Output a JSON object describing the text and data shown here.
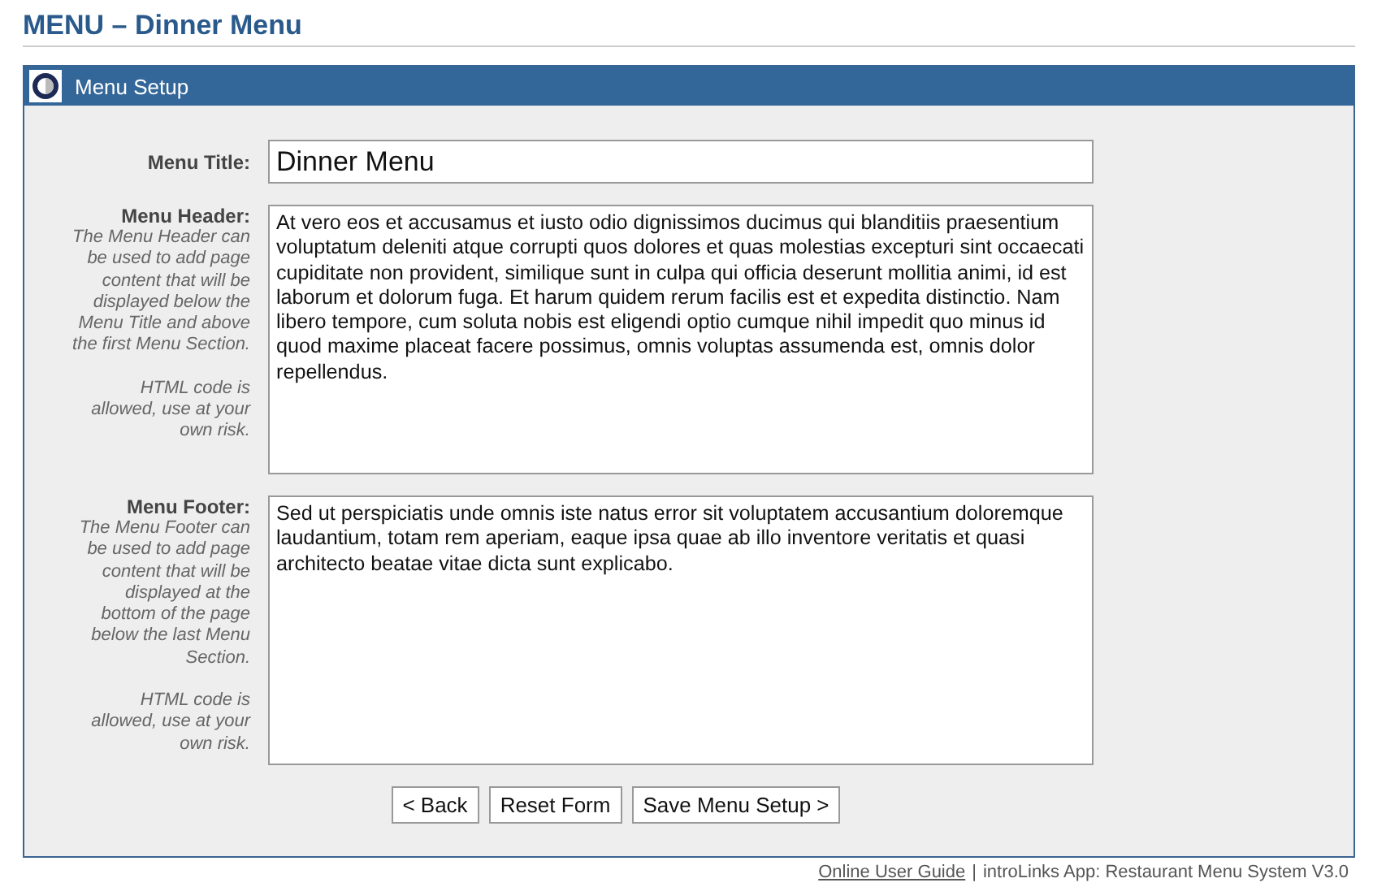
{
  "page_title": "MENU – Dinner Menu",
  "panel": {
    "title": "Menu Setup"
  },
  "fields": [
    {
      "kind": "input",
      "label": "Menu Title:",
      "value": "Dinner Menu"
    },
    {
      "kind": "textarea",
      "label": "Menu Header:",
      "help": [
        "The Menu Header can be used to add page content that will be displayed below the Menu Title and above the first Menu Section.",
        "HTML code is allowed, use at your own risk."
      ],
      "value": "At vero eos et accusamus et iusto odio dignissimos ducimus qui blanditiis praesentium voluptatum deleniti atque corrupti quos dolores et quas molestias excepturi sint occaecati cupiditate non provident, similique sunt in culpa qui officia deserunt mollitia animi, id est laborum et dolorum fuga. Et harum quidem rerum facilis est et expedita distinctio. Nam libero tempore, cum soluta nobis est eligendi optio cumque nihil impedit quo minus id quod maxime placeat facere possimus, omnis voluptas assumenda est, omnis dolor repellendus."
    },
    {
      "kind": "textarea",
      "label": "Menu Footer:",
      "help": [
        "The Menu Footer can be used to add page content that will be displayed at the bottom of the page below the last Menu Section.",
        "HTML code is allowed, use at your own risk."
      ],
      "value": "Sed ut perspiciatis unde omnis iste natus error sit voluptatem accusantium doloremque laudantium, totam rem aperiam, eaque ipsa quae ab illo inventore veritatis et quasi architecto beatae vitae dicta sunt explicabo."
    }
  ],
  "buttons": [
    "< Back",
    "Reset Form",
    "Save Menu Setup >"
  ],
  "footer": {
    "link": "Online User Guide",
    "separator": "|",
    "text": "introLinks App: Restaurant Menu System V3.0"
  }
}
